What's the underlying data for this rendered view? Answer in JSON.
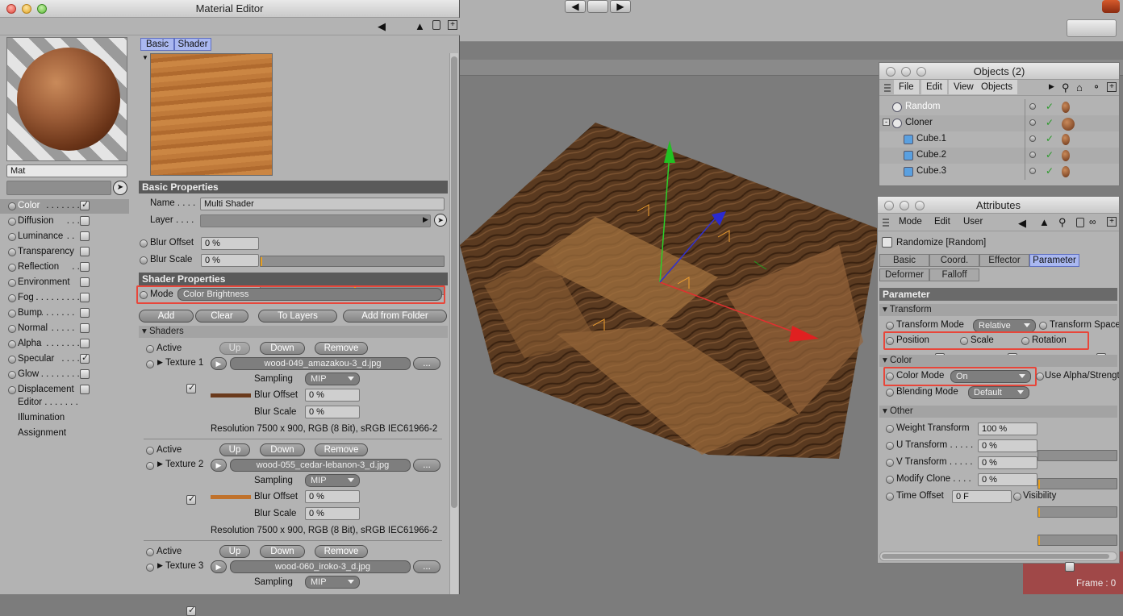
{
  "material_editor": {
    "title": "Material Editor",
    "material_name": "Mat",
    "channels": [
      {
        "label": "Color",
        "dots": " . . . . . . .",
        "checked": true
      },
      {
        "label": "Diffusion",
        "dots": " . . . .",
        "checked": false
      },
      {
        "label": "Luminance",
        "dots": " . .",
        "checked": false
      },
      {
        "label": "Transparency",
        "dots": "",
        "checked": false
      },
      {
        "label": "Reflection",
        "dots": " . .",
        "checked": false
      },
      {
        "label": "Environment",
        "dots": "",
        "checked": false
      },
      {
        "label": "Fog",
        "dots": " . . . . . . . . .",
        "checked": false
      },
      {
        "label": "Bump",
        "dots": " . . . . . . .",
        "checked": false
      },
      {
        "label": "Normal",
        "dots": " . . . . .",
        "checked": false
      },
      {
        "label": "Alpha",
        "dots": " . . . . . . .",
        "checked": false
      },
      {
        "label": "Specular",
        "dots": " . . . .",
        "checked": true
      },
      {
        "label": "Glow",
        "dots": " . . . . . . . .",
        "checked": false
      },
      {
        "label": "Displacement",
        "dots": "",
        "checked": false
      }
    ],
    "extras": [
      "Editor . . . . . . .",
      "Illumination",
      "Assignment"
    ],
    "tabs": [
      "Basic",
      "Shader"
    ],
    "basic_properties": {
      "header": "Basic Properties",
      "name_label": "Name . . . .",
      "name_value": "Multi Shader",
      "layer_label": "Layer . . . .",
      "blur_offset_label": "Blur Offset",
      "blur_offset_value": "0 %",
      "blur_scale_label": "Blur Scale",
      "blur_scale_value": "0 %"
    },
    "shader_properties": {
      "header": "Shader Properties",
      "mode_label": "Mode",
      "mode_value": "Color Brightness",
      "buttons": [
        "Add",
        "Clear",
        "To Layers",
        "Add from Folder"
      ],
      "shaders_header": "Shaders"
    },
    "textures": [
      {
        "active_label": "Active",
        "up": "Up",
        "down": "Down",
        "remove": "Remove",
        "label": "Texture 1",
        "file": "wood-049_amazakou-3_d.jpg",
        "sampling_label": "Sampling",
        "sampling": "MIP",
        "blur_offset_label": "Blur Offset",
        "blur_offset": "0 %",
        "blur_scale_label": "Blur Scale",
        "blur_scale": "0 %",
        "resolution": "Resolution 7500 x 900, RGB (8 Bit), sRGB IEC61966-2",
        "swatch": "#6a3a1c"
      },
      {
        "active_label": "Active",
        "up": "Up",
        "down": "Down",
        "remove": "Remove",
        "label": "Texture 2",
        "file": "wood-055_cedar-lebanon-3_d.jpg",
        "sampling_label": "Sampling",
        "sampling": "MIP",
        "blur_offset_label": "Blur Offset",
        "blur_offset": "0 %",
        "blur_scale_label": "Blur Scale",
        "blur_scale": "0 %",
        "resolution": "Resolution 7500 x 900, RGB (8 Bit), sRGB IEC61966-2",
        "swatch": "#c0722c"
      },
      {
        "active_label": "Active",
        "up": "Up",
        "down": "Down",
        "remove": "Remove",
        "label": "Texture 3",
        "file": "wood-060_iroko-3_d.jpg",
        "sampling_label": "Sampling",
        "sampling": "MIP"
      }
    ],
    "more_button": "..."
  },
  "objects": {
    "title": "Objects (2)",
    "menu": [
      "File",
      "Edit",
      "View",
      "Objects"
    ],
    "items": [
      {
        "name": "Random",
        "selected": true
      },
      {
        "name": "Cloner",
        "selected": false
      },
      {
        "name": "Cube.1",
        "selected": false
      },
      {
        "name": "Cube.2",
        "selected": false
      },
      {
        "name": "Cube.3",
        "selected": false
      }
    ]
  },
  "attributes": {
    "title": "Attributes",
    "menu": [
      "Mode",
      "Edit",
      "User"
    ],
    "object_label": "Randomize [Random]",
    "tabs": [
      "Basic",
      "Coord.",
      "Effector",
      "Parameter",
      "Deformer",
      "Falloff"
    ],
    "active_tab": "Parameter",
    "parameter_header": "Parameter",
    "transform_header": "Transform",
    "transform_mode_label": "Transform Mode",
    "transform_mode_value": "Relative",
    "transform_space_label": "Transform Space",
    "position_label": "Position",
    "scale_label": "Scale",
    "rotation_label": "Rotation",
    "color_header": "Color",
    "color_mode_label": "Color Mode",
    "color_mode_value": "On",
    "use_alpha_label": "Use Alpha/Strength",
    "blending_mode_label": "Blending Mode",
    "blending_mode_value": "Default",
    "other_header": "Other",
    "weight_transform_label": "Weight Transform",
    "weight_transform_value": "100 %",
    "u_transform_label": "U Transform . . . . .",
    "u_transform_value": "0 %",
    "v_transform_label": "V Transform . . . . .",
    "v_transform_value": "0 %",
    "modify_clone_label": "Modify Clone . . . .",
    "modify_clone_value": "0 %",
    "time_offset_label": "Time Offset",
    "time_offset_value": "0 F",
    "visibility_label": "Visibility"
  },
  "status": {
    "frame": "Frame : 0"
  },
  "colors": {
    "highlight": "#e8463a",
    "tab_active": "#aab8f0",
    "viewport_bg": "#7c7c7c"
  }
}
